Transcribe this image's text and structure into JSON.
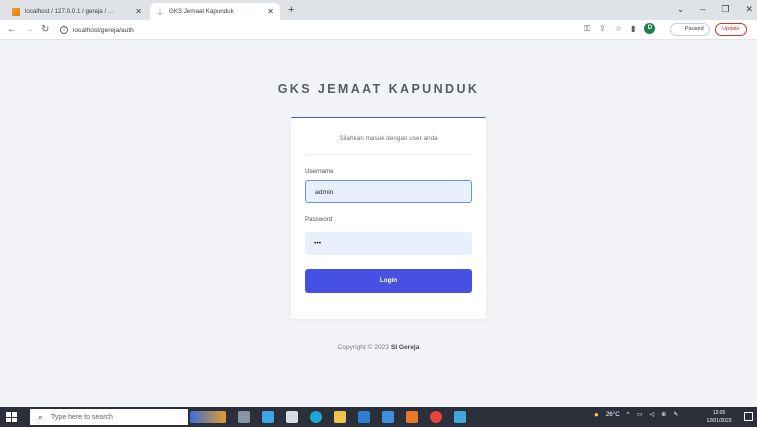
{
  "browser": {
    "tabs": [
      {
        "title": "localhost / 127.0.0.1 / gereja / ...",
        "favicon": "xampp-icon",
        "active": false
      },
      {
        "title": "GKS Jemaat Kapunduk",
        "favicon": "page-icon",
        "active": true
      }
    ],
    "new_tab": "+",
    "url": "localhost/gereja/auth",
    "profile_letter": "D",
    "paused_label": "Paused",
    "update_label": "Update"
  },
  "page": {
    "brand": "GKS JEMAAT KAPUNDUK",
    "subtitle": "Silahkan masuk dengan user anda",
    "username_label": "Username",
    "username_value": "admin",
    "password_label": "Password",
    "password_value": "•••",
    "login_label": "Login",
    "footer_prefix": "Copyright © 2023",
    "footer_brand": "SI Gereja",
    "accent_color": "#4651e4"
  },
  "taskbar": {
    "search_placeholder": "Type here to search",
    "weather": "26°C",
    "time": "12:05",
    "date": "12/01/2023"
  }
}
